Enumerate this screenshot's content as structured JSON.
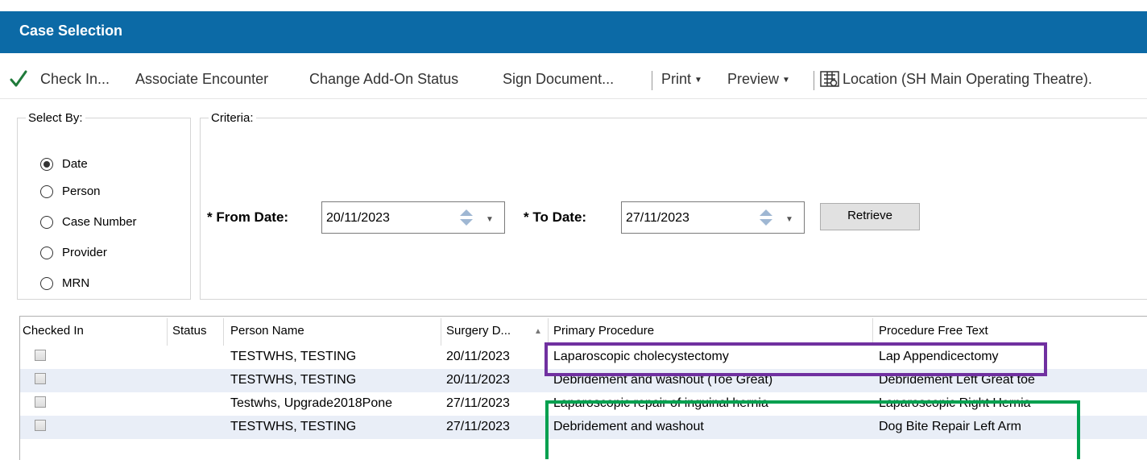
{
  "window": {
    "title": "Case Selection"
  },
  "toolbar": {
    "check_in": "Check In...",
    "associate_encounter": "Associate Encounter",
    "change_addon_status": "Change Add-On Status",
    "sign_document": "Sign Document...",
    "print": "Print",
    "preview": "Preview",
    "location": "Location (SH Main Operating Theatre)."
  },
  "select_by": {
    "legend": "Select By:",
    "options": [
      "Date",
      "Person",
      "Case Number",
      "Provider",
      "MRN"
    ],
    "selected": "Date"
  },
  "criteria": {
    "legend": "Criteria:",
    "from_label": "* From Date:",
    "from_value": "20/11/2023",
    "to_label": "* To Date:",
    "to_value": "27/11/2023",
    "retrieve": "Retrieve"
  },
  "grid": {
    "columns": [
      "Checked In",
      "Status",
      "Person Name",
      "Surgery D...",
      "Primary Procedure",
      "Procedure Free Text"
    ],
    "sorted_column": "Surgery D...",
    "rows": [
      {
        "checked": false,
        "status": "",
        "person": "TESTWHS, TESTING",
        "date": "20/11/2023",
        "procedure": "Laparoscopic cholecystectomy",
        "free_text": "Lap Appendicectomy"
      },
      {
        "checked": false,
        "status": "",
        "person": "TESTWHS, TESTING",
        "date": "20/11/2023",
        "procedure": "Debridement and washout (Toe Great)",
        "free_text": "Debridement Left Great toe"
      },
      {
        "checked": false,
        "status": "",
        "person": "Testwhs, Upgrade2018Pone",
        "date": "27/11/2023",
        "procedure": "Laparoscopic repair of inguinal hernia",
        "free_text": "Laparoscopic Right Hernia"
      },
      {
        "checked": false,
        "status": "",
        "person": "TESTWHS, TESTING",
        "date": "27/11/2023",
        "procedure": "Debridement and washout",
        "free_text": "Dog Bite Repair Left Arm"
      }
    ]
  },
  "colors": {
    "titlebar": "#0c6aa6",
    "row_alt": "#e9eef7",
    "highlight_purple": "#7030a0",
    "highlight_green": "#00a04f"
  }
}
